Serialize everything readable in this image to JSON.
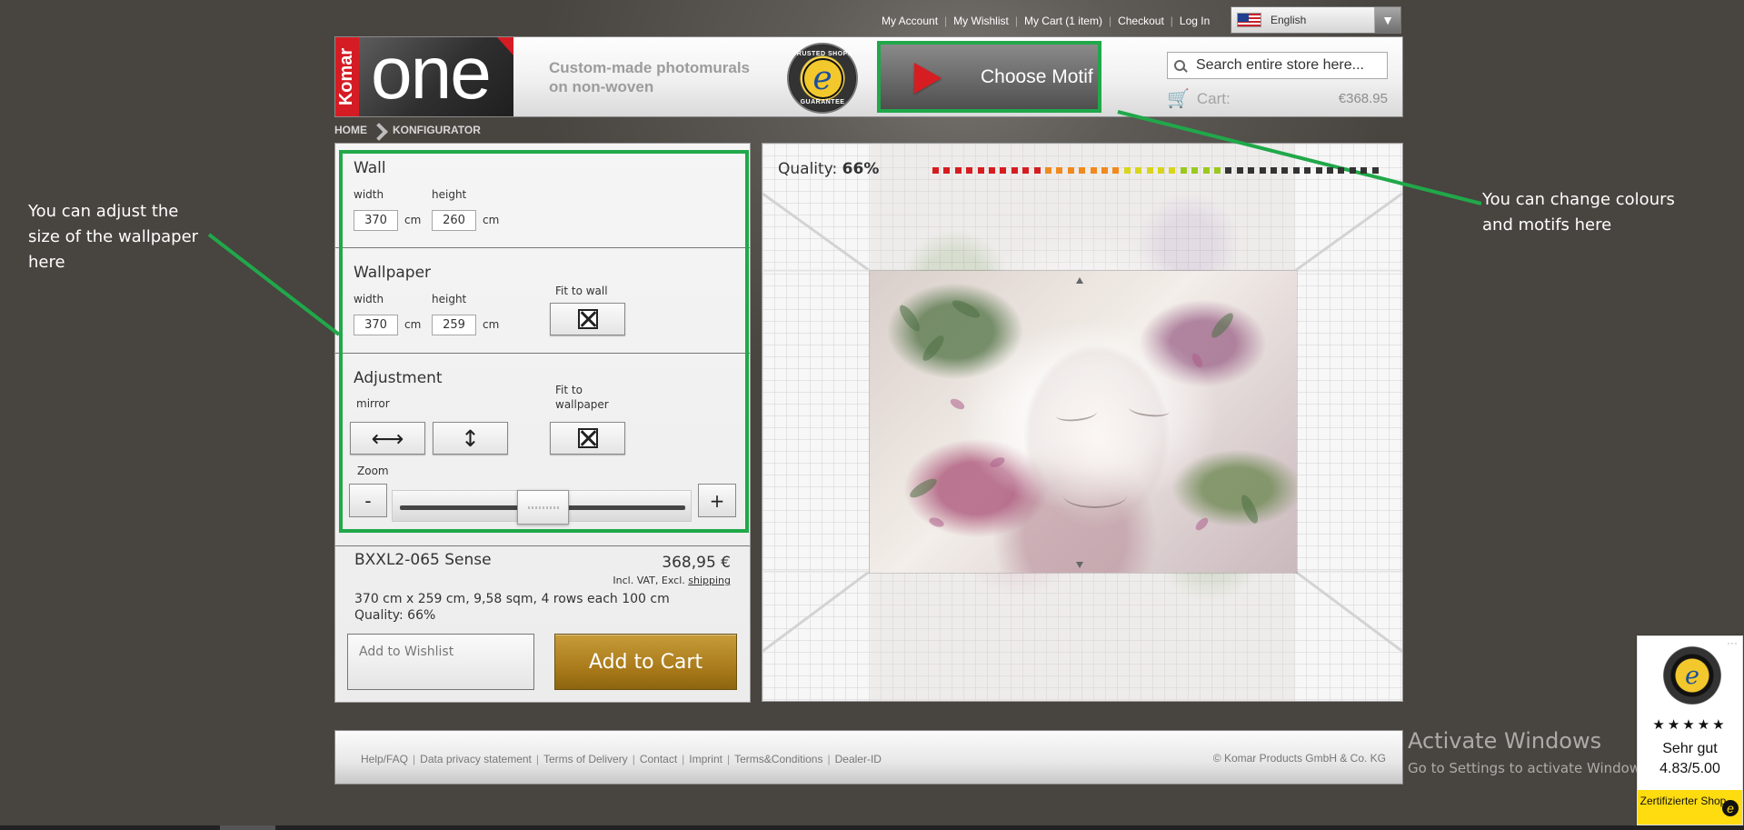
{
  "top_nav": {
    "items": [
      "My Account",
      "My Wishlist",
      "My Cart (1 item)",
      "Checkout",
      "Log In"
    ],
    "separator": "|"
  },
  "language": {
    "selected": "English",
    "icon": "chevron-down-icon"
  },
  "header": {
    "brand_komar": "Komar",
    "brand_one": "one",
    "tagline": "Custom-made photomurals on non-woven",
    "trust_seal_top": "TRUSTED SHOPS",
    "trust_seal_bottom": "GUARANTEE",
    "trust_seal_letter": "e",
    "choose_motif": "Choose Motif",
    "search_placeholder": "Search entire store here...",
    "cart_label": "Cart:",
    "cart_total": "€368.95"
  },
  "breadcrumb": {
    "home": "HOME",
    "current": "KONFIGURATOR"
  },
  "configurator": {
    "wall": {
      "title": "Wall",
      "width_label": "width",
      "height_label": "height",
      "width": "370",
      "height": "260",
      "unit": "cm"
    },
    "wallpaper": {
      "title": "Wallpaper",
      "width_label": "width",
      "height_label": "height",
      "width": "370",
      "height": "259",
      "unit": "cm",
      "fit_label": "Fit to wall"
    },
    "adjustment": {
      "title": "Adjustment",
      "mirror_label": "mirror",
      "fit_label": "Fit to wallpaper",
      "zoom_label": "Zoom",
      "zoom_minus": "-",
      "zoom_plus": "+",
      "zoom_level": 0.5
    }
  },
  "product": {
    "name": "BXXL2-065 Sense",
    "price": "368,95 €",
    "vat_prefix": "Incl. VAT, Excl.",
    "shipping": "shipping",
    "details": "370 cm x 259 cm, 9,58 sqm, 4 rows each 100 cm",
    "quality": "Quality: 66%",
    "wishlist": "Add to Wishlist",
    "add_to_cart": "Add to Cart"
  },
  "preview": {
    "quality_label": "Quality:",
    "quality_value": "66%",
    "quality_level": 0.66,
    "quality_segments": 40,
    "colors": {
      "red": "#d51d20",
      "orange": "#f08a1d",
      "yellow": "#d8d51b",
      "green": "#9ac91f",
      "empty": "#333333"
    }
  },
  "annotations": {
    "left": "You can adjust the size of the wallpaper here",
    "right": "You can change colours and motifs here",
    "accent": "#20a84a"
  },
  "footer": {
    "links": [
      "Help/FAQ",
      "Data privacy statement",
      "Terms of Delivery",
      "Contact",
      "Imprint",
      "Terms&Conditions",
      "Dealer-ID"
    ],
    "separator": "|",
    "copyright": "© Komar Products GmbH & Co. KG"
  },
  "watermark": {
    "title": "Activate Windows",
    "subtitle": "Go to Settings to activate Windows."
  },
  "trusted_widget": {
    "dots": "···",
    "stars": "★★★★★",
    "rating_label": "Sehr gut",
    "rating_value": "4.83/5.00",
    "certified": "Zertifizierter Shop",
    "letter": "e"
  }
}
